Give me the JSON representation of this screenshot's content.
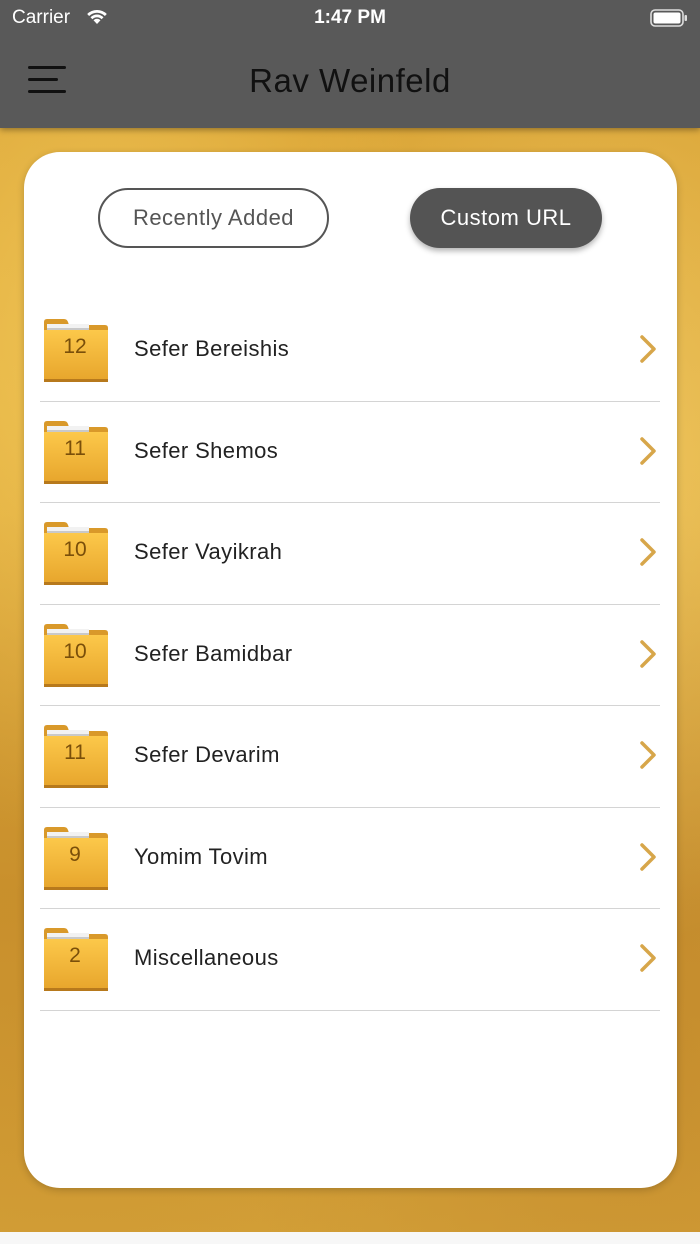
{
  "status_bar": {
    "carrier": "Carrier",
    "time": "1:47 PM"
  },
  "header": {
    "title": "Rav Weinfeld",
    "menu_icon": "hamburger-menu-icon"
  },
  "tabs": {
    "recently_added": "Recently Added",
    "custom_url": "Custom URL"
  },
  "folders": [
    {
      "count": "12",
      "label": "Sefer Bereishis"
    },
    {
      "count": "11",
      "label": "Sefer Shemos"
    },
    {
      "count": "10",
      "label": "Sefer Vayikrah"
    },
    {
      "count": "10",
      "label": "Sefer Bamidbar"
    },
    {
      "count": "11",
      "label": "Sefer Devarim"
    },
    {
      "count": "9",
      "label": "Yomim Tovim"
    },
    {
      "count": "2",
      "label": "Miscellaneous"
    }
  ],
  "colors": {
    "header_bg": "#595959",
    "accent_gold": "#e2a836",
    "chevron": "#d7a64a",
    "active_tab": "#545454"
  }
}
